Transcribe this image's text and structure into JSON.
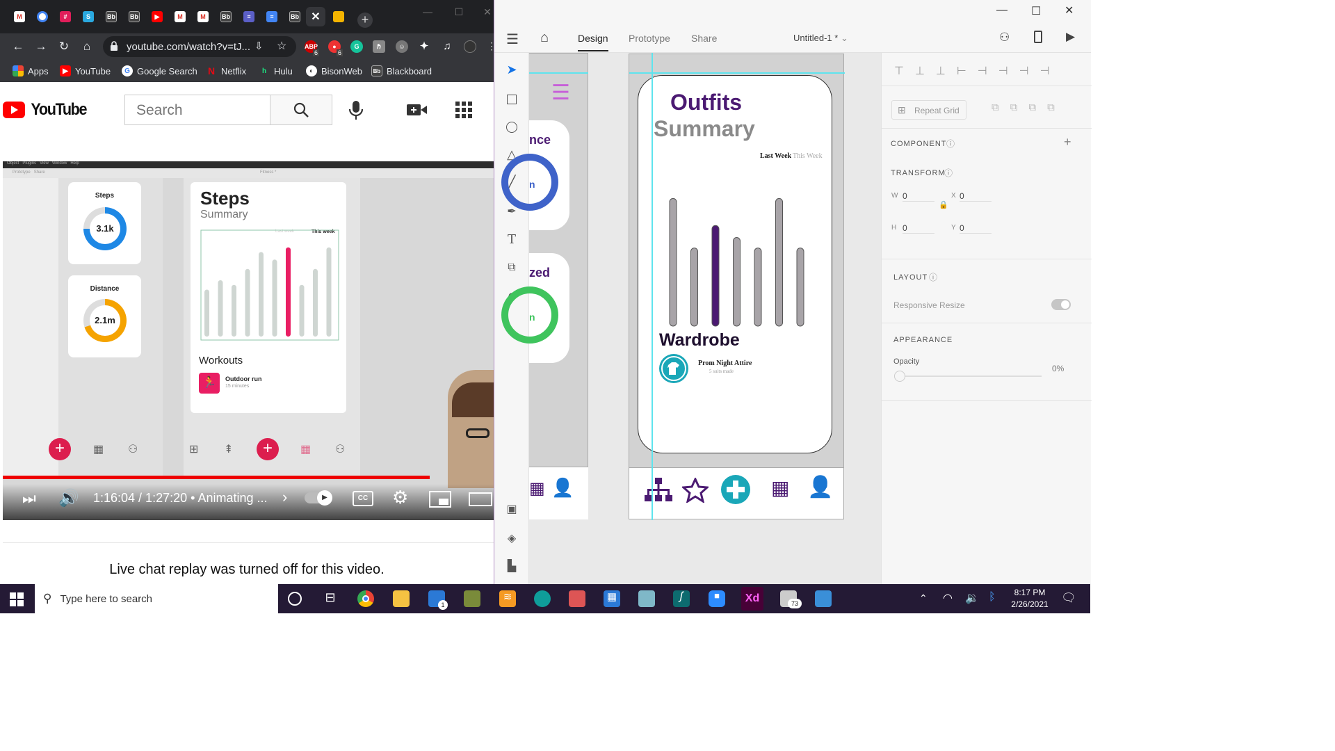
{
  "chrome": {
    "tabs": [
      "gmail",
      "chrome",
      "slack",
      "stackedit",
      "blackboard",
      "blackboard",
      "youtube",
      "gmail",
      "gmail",
      "blackboard",
      "tasks",
      "docs",
      "blackboard",
      "active-close",
      "slides"
    ],
    "new_tab": "+",
    "url": "youtube.com/watch?v=tJ...",
    "extensions": {
      "abp_count": "6",
      "rec_count": "6"
    },
    "bookmarks": [
      {
        "label": "Apps",
        "icon": "apps-grid-icon"
      },
      {
        "label": "YouTube",
        "icon": "youtube-icon"
      },
      {
        "label": "Google Search",
        "icon": "google-icon"
      },
      {
        "label": "Netflix",
        "icon": "netflix-icon"
      },
      {
        "label": "Hulu",
        "icon": "hulu-icon"
      },
      {
        "label": "BisonWeb",
        "icon": "bisonweb-icon"
      },
      {
        "label": "Blackboard",
        "icon": "blackboard-icon"
      }
    ]
  },
  "youtube": {
    "logo": "YouTube",
    "search_placeholder": "Search",
    "video": {
      "menu": [
        "Object",
        "Plugins",
        "View",
        "Window",
        "Help"
      ],
      "tabs": [
        "Prototype",
        "Share"
      ],
      "doc_title": "Fitness *",
      "steps_card": {
        "label": "Steps",
        "value": "3.1k"
      },
      "distance_card": {
        "label": "Distance",
        "value": "2.1m"
      },
      "summary_title": "Steps",
      "summary_subtitle": "Summary",
      "legend_last": "Last week",
      "legend_this": "This week",
      "workouts_title": "Workouts",
      "workout_name": "Outdoor run",
      "workout_time": "15 minutes",
      "bar_levels": [
        0.5,
        0.6,
        0.55,
        0.72,
        0.9,
        0.82,
        0.95,
        0.55,
        0.72,
        0.95
      ],
      "highlight_index": 6
    },
    "time": "1:16:04 / 1:27:20",
    "chapter": "Animating ...",
    "progress_fraction": 0.87,
    "live_chat_note": "Live chat replay was turned off for this video."
  },
  "xd": {
    "tabs": [
      "Design",
      "Prototype",
      "Share"
    ],
    "doc_title": "Untitled-1 *",
    "artboard": {
      "title": "Outfits",
      "subtitle": "Summary",
      "legend_last": "Last Week",
      "legend_this": "This Week",
      "bar_levels": [
        0.85,
        0.52,
        0.67,
        0.59,
        0.52,
        0.85,
        0.52
      ],
      "highlight_index": 2,
      "section_title": "Wardrobe",
      "item_title": "Prom Night Attire",
      "item_subtitle": "5 suits made"
    },
    "left_artboard": {
      "card1_fragment": "nce",
      "card1_ring_text": "n",
      "card2_fragment": "zed",
      "card2_ring_text": "n"
    },
    "props": {
      "repeat_grid": "Repeat Grid",
      "component": "COMPONENT",
      "transform": "TRANSFORM",
      "w_label": "W",
      "w": "0",
      "x_label": "X",
      "x": "0",
      "h_label": "H",
      "h": "0",
      "y_label": "Y",
      "y": "0",
      "layout": "LAYOUT",
      "responsive_resize": "Responsive Resize",
      "appearance": "APPEARANCE",
      "opacity_label": "Opacity",
      "opacity_value": "0%"
    }
  },
  "taskbar": {
    "search_placeholder": "Type here to search",
    "mail_badge": "1",
    "chat_badge": "73",
    "time": "8:17 PM",
    "date": "2/26/2021"
  },
  "colors": {
    "purple": "#4b1a72",
    "bar_gray": "#a8a4a8",
    "teal": "#1aa7b8",
    "yt_red": "#ff0000",
    "steps_blue": "#1e88e5",
    "distance_orange": "#f5a300",
    "pink": "#e91e63"
  }
}
